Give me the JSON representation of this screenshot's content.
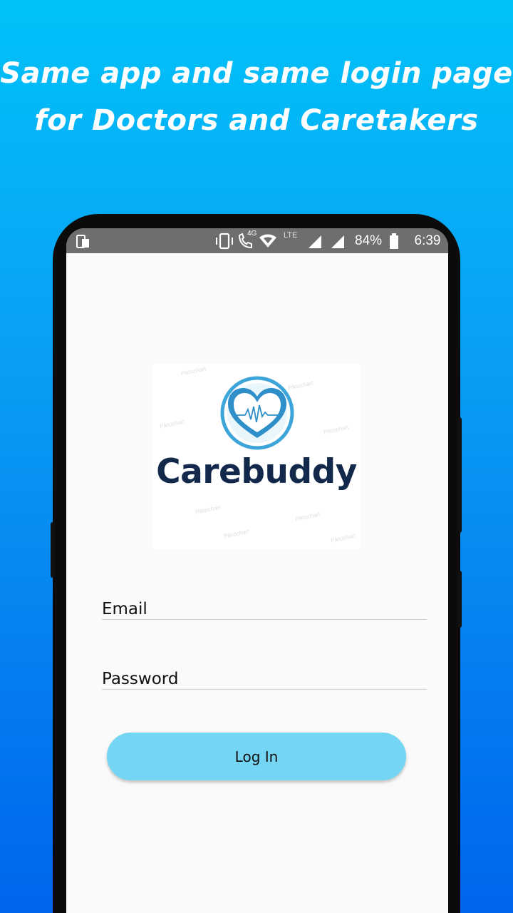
{
  "banner": {
    "line1": "Same app and same login page",
    "line2": "for Doctors and Caretakers"
  },
  "status_bar": {
    "network_label": "4G",
    "lte_label": "LTE",
    "battery_percent": "84%",
    "time": "6:39",
    "icons": [
      "screenshot-icon",
      "vibrate-icon",
      "call-4g-icon",
      "wifi-icon",
      "signal-icon",
      "signal-icon",
      "battery-icon"
    ]
  },
  "logo": {
    "brand_name": "Carebuddy",
    "watermark_text": "Piktochart",
    "colors": {
      "ring": "#3da5d9",
      "heart": "#2f8fc9",
      "text": "#13294b"
    }
  },
  "form": {
    "email_label": "Email",
    "password_label": "Password",
    "login_button": "Log In"
  },
  "colors": {
    "accent_button": "#74d5f5",
    "gradient_top": "#00c2f8",
    "gradient_bottom": "#0065ec"
  }
}
